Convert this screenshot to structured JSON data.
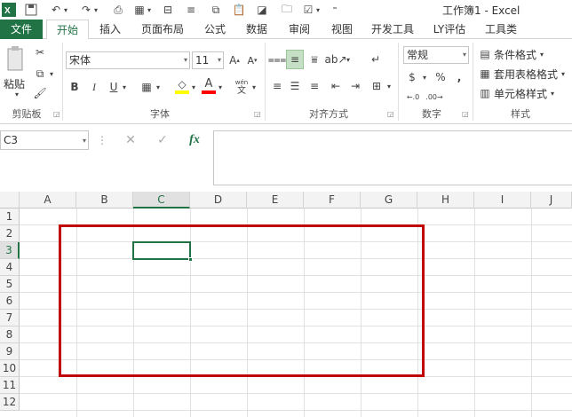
{
  "window": {
    "title": "工作簿1 - Excel"
  },
  "tabs": [
    {
      "label": "文件"
    },
    {
      "label": "开始"
    },
    {
      "label": "插入"
    },
    {
      "label": "页面布局"
    },
    {
      "label": "公式"
    },
    {
      "label": "数据"
    },
    {
      "label": "审阅"
    },
    {
      "label": "视图"
    },
    {
      "label": "开发工具"
    },
    {
      "label": "LY评估"
    },
    {
      "label": "工具类"
    }
  ],
  "ribbon": {
    "groups": {
      "clipboard": "剪贴板",
      "font": "字体",
      "alignment": "对齐方式",
      "number": "数字",
      "styles": "样式"
    },
    "paste_label": "粘贴",
    "font_name": "宋体",
    "font_size": "11",
    "number_format": "常规",
    "conditional_format": "条件格式",
    "table_format": "套用表格格式",
    "cell_styles": "单元格样式",
    "wen_label": "wén",
    "wen_char": "文"
  },
  "formula_bar": {
    "name_box": "C3",
    "fx": "fx"
  },
  "sheet": {
    "columns": [
      "A",
      "B",
      "C",
      "D",
      "E",
      "F",
      "G",
      "H",
      "I",
      "J"
    ],
    "rows": [
      "1",
      "2",
      "3",
      "4",
      "5",
      "6",
      "7",
      "8",
      "9",
      "10",
      "11",
      "12"
    ],
    "active_cell": "C3",
    "highlight_color": "#c00000",
    "accent_color": "#217346"
  }
}
